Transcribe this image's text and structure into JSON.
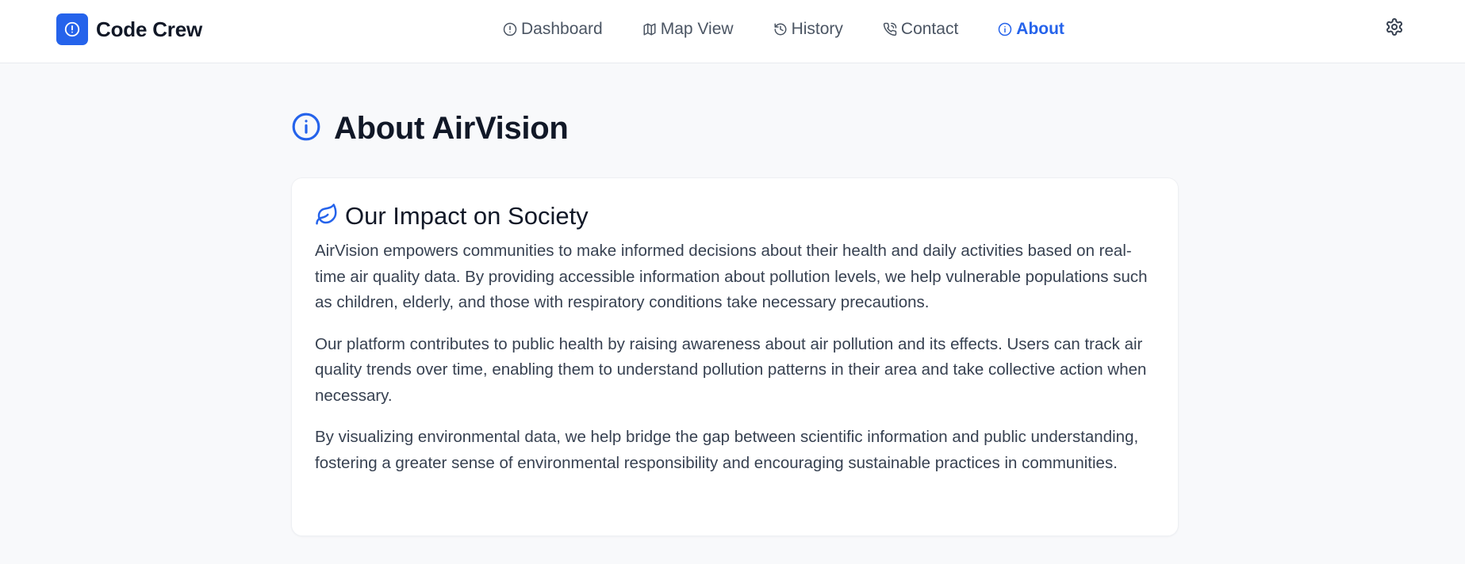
{
  "brand": {
    "name": "Code Crew",
    "logo_icon": "alert-circle-icon",
    "accent": "#2563eb"
  },
  "nav": {
    "items": [
      {
        "label": "Dashboard",
        "icon": "alert-circle-icon"
      },
      {
        "label": "Map View",
        "icon": "map-icon"
      },
      {
        "label": "History",
        "icon": "history-icon"
      },
      {
        "label": "Contact",
        "icon": "phone-icon"
      },
      {
        "label": "About",
        "icon": "info-icon",
        "active": true
      }
    ]
  },
  "header": {
    "settings_icon": "gear-icon"
  },
  "page": {
    "title": "About AirVision",
    "title_icon": "info-icon"
  },
  "section": {
    "title": "Our Impact on Society",
    "title_icon": "leaf-icon",
    "paragraphs": [
      "AirVision empowers communities to make informed decisions about their health and daily activities based on real-time air quality data. By providing accessible information about pollution levels, we help vulnerable populations such as children, elderly, and those with respiratory conditions take necessary precautions.",
      "Our platform contributes to public health by raising awareness about air pollution and its effects. Users can track air quality trends over time, enabling them to understand pollution patterns in their area and take collective action when necessary.",
      "By visualizing environmental data, we help bridge the gap between scientific information and public understanding, fostering a greater sense of environmental responsibility and encouraging sustainable practices in communities."
    ]
  }
}
